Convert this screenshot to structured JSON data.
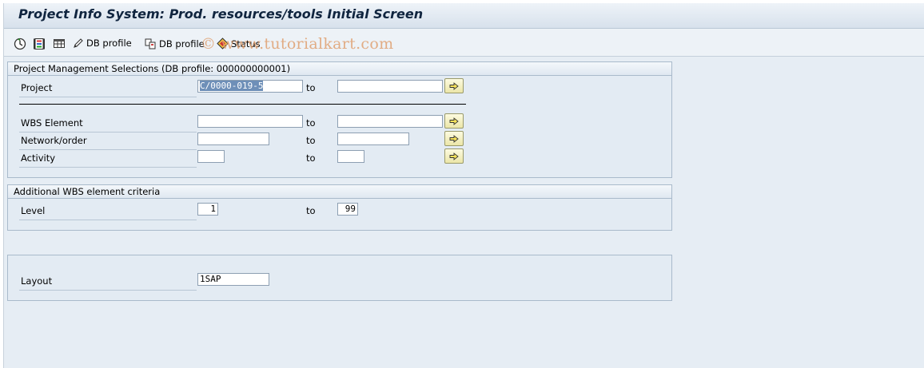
{
  "window": {
    "title": "Project Info System: Prod. resources/tools Initial Screen"
  },
  "toolbar": {
    "items": [
      {
        "icon": "execute-icon",
        "label": ""
      },
      {
        "icon": "variant-icon",
        "label": ""
      },
      {
        "icon": "layout-icon",
        "label": ""
      },
      {
        "icon": "pencil-icon",
        "label": "DB profile"
      },
      {
        "icon": "db-profile-icon",
        "label": "DB profile"
      },
      {
        "icon": "status-icon",
        "label": "Status"
      }
    ],
    "watermark": "© www.tutorialkart.com"
  },
  "project_selection": {
    "header": "Project Management Selections (DB profile: 000000000001)",
    "rows": [
      {
        "label": "Project",
        "from": "C/0000-019-5",
        "to_label": "to",
        "to": ""
      },
      {
        "label": "WBS Element",
        "from": "",
        "to_label": "to",
        "to": ""
      },
      {
        "label": "Network/order",
        "from": "",
        "to_label": "to",
        "to": ""
      },
      {
        "label": "Activity",
        "from": "",
        "to_label": "to",
        "to": ""
      }
    ]
  },
  "wbs_criteria": {
    "header": "Additional WBS element criteria",
    "level_label": "Level",
    "level_from": "1",
    "to_label": "to",
    "level_to": "99"
  },
  "layout_group": {
    "label": "Layout",
    "value": "1SAP"
  },
  "colors": {
    "background": "#e6edf4",
    "title": "#10253f",
    "selected_text_bg": "#6e8fb8",
    "arrow_button": "#ece6a8"
  }
}
